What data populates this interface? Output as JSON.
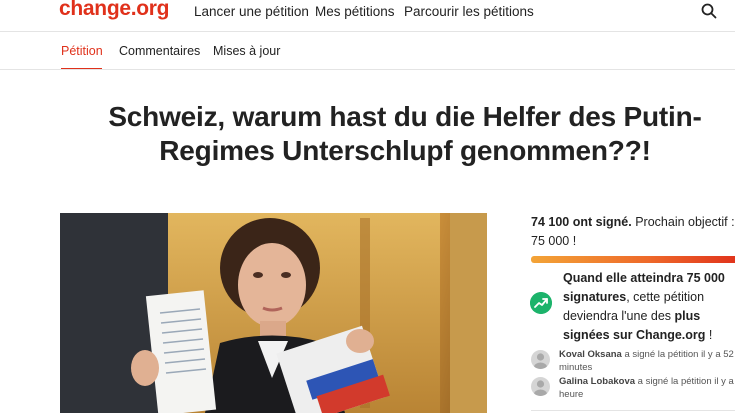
{
  "header": {
    "logo": "change.org",
    "nav": [
      "Lancer une pétition",
      "Mes pétitions",
      "Parcourir les pétitions"
    ],
    "search_icon": "search-icon"
  },
  "tabs": [
    {
      "label": "Pétition",
      "active": true
    },
    {
      "label": "Commentaires",
      "active": false
    },
    {
      "label": "Mises à jour",
      "active": false
    }
  ],
  "petition": {
    "title_line1": "Schweiz, warum hast du die Helfer des Putin-",
    "title_line2": "Regimes Unterschlupf genommen??!"
  },
  "signatures": {
    "count_text": "74 100 ont signé.",
    "goal_text_1": " Prochain objectif :",
    "goal_text_2": "75 000 !",
    "progress_fraction": 0.988
  },
  "milestone": {
    "part1": "Quand elle atteindra 75 000 signatures",
    "part2": ", cette pétition deviendra l'une des ",
    "part3": "plus signées sur Change.org",
    "part4": " !",
    "icon": "trending-up-icon"
  },
  "activity": [
    {
      "name": "Koval Oksana",
      "text": " a signé la pétition il y a 52 minutes"
    },
    {
      "name": "Galina Lobakova",
      "text": " a signé la pétition il y a 1 heure"
    }
  ],
  "colors": {
    "brand": "#e0311b",
    "success": "#1cb36b"
  }
}
